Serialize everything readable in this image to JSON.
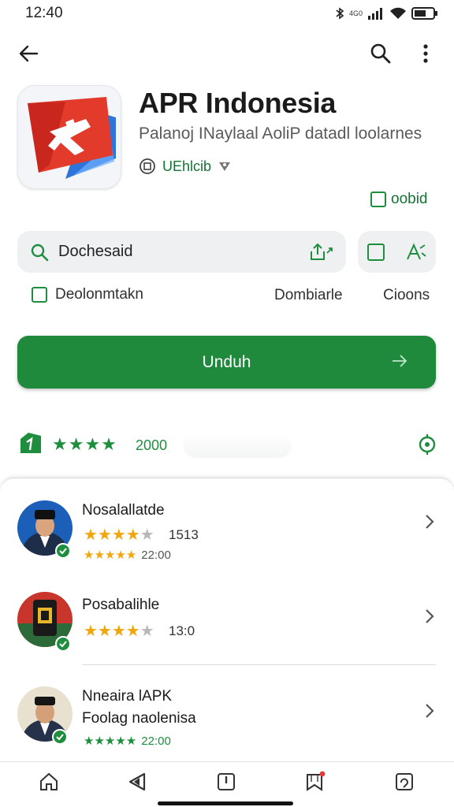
{
  "status_bar": {
    "time": "12:40",
    "network_small": "4G0",
    "icons": [
      "bluetooth-icon",
      "signal-icon",
      "wifi-icon",
      "battery-icon"
    ]
  },
  "top_bar": {
    "icons": [
      "back-arrow-icon",
      "search-icon",
      "more-vert-icon"
    ]
  },
  "app": {
    "title": "APR Indonesia",
    "subtitle": "Palanoj INaylaal AoliP datadl loolarnes",
    "developer": "UEhlcib",
    "tag": "oobid"
  },
  "search": {
    "label": "Dochesaid"
  },
  "options": {
    "checkbox_label": "Deolonmtakn",
    "option2": "Dombiarle",
    "option3": "Cioons"
  },
  "install": {
    "label": "Unduh"
  },
  "rating": {
    "stars_text": "★★★★",
    "count": "2000"
  },
  "list": [
    {
      "name": "Nosalallatde",
      "stars": 4,
      "score": "1513",
      "sub_time": "22:00"
    },
    {
      "name": "Posabalihle",
      "stars": 4,
      "score": "13:0"
    },
    {
      "name": "Nneaira lAPK",
      "subtitle": "Foolag naolenisa",
      "sub_time": "22:00"
    }
  ],
  "bottom_nav": {
    "icons": [
      "home-icon",
      "play-icon",
      "book-icon",
      "bookmark-icon",
      "profile-icon"
    ]
  },
  "colors": {
    "accent_green": "#1f8a3c",
    "star_orange": "#f2a60c"
  }
}
